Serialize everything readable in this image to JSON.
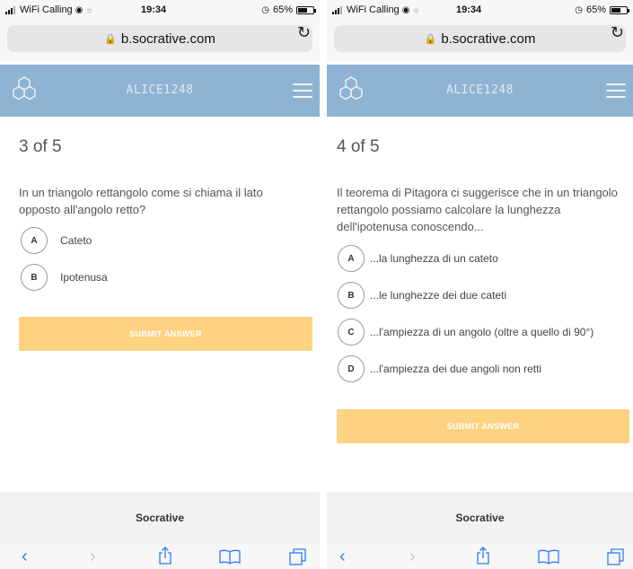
{
  "screens": [
    {
      "status": {
        "carrier": "WiFi Calling",
        "time": "19:34",
        "battery": "65%",
        "battery_level": 0.65
      },
      "browser": {
        "url": "b.socrative.com"
      },
      "header": {
        "room": "ALICE1248"
      },
      "quiz": {
        "progress": "3 of 5",
        "question": "In un triangolo rettangolo come si chiama il lato opposto all'angolo retto?",
        "answers": [
          {
            "letter": "A",
            "text": "Cateto"
          },
          {
            "letter": "B",
            "text": "Ipotenusa"
          }
        ],
        "submit_label": "SUBMIT ANSWER"
      },
      "footer": {
        "brand": "Socrative"
      }
    },
    {
      "status": {
        "carrier": "WiFi Calling",
        "time": "19:34",
        "battery": "65%",
        "battery_level": 0.65
      },
      "browser": {
        "url": "b.socrative.com"
      },
      "header": {
        "room": "ALICE1248"
      },
      "quiz": {
        "progress": "4 of 5",
        "question": "Il teorema di Pitagora ci suggerisce che in un triangolo rettangolo possiamo calcolare la lunghezza dell'ipotenusa conoscendo...",
        "answers": [
          {
            "letter": "A",
            "text": "...la lunghezza di un cateto"
          },
          {
            "letter": "B",
            "text": "...le lunghezze dei due cateti"
          },
          {
            "letter": "C",
            "text": "...l'ampiezza di un angolo (oltre a quello di 90°)"
          },
          {
            "letter": "D",
            "text": "...l'ampiezza dei due angoli non retti"
          }
        ],
        "submit_label": "SUBMIT ANSWER"
      },
      "footer": {
        "brand": "Socrative"
      }
    }
  ],
  "icons": {
    "signal": "signal-bars-icon",
    "wifi": "wifi-icon",
    "alarm": "alarm-icon",
    "lock": "lock-icon",
    "reload": "reload-icon",
    "logo": "socrative-hexagon-logo",
    "menu": "hamburger-menu-icon",
    "back": "chevron-left-icon",
    "forward": "chevron-right-icon",
    "share": "share-icon",
    "bookmarks": "book-icon",
    "tabs": "tabs-icon"
  },
  "colors": {
    "header": "#8fb3d2",
    "submit": "#fdd281",
    "safari_blue": "#2d7cf6",
    "footer": "#f2f2f2"
  }
}
